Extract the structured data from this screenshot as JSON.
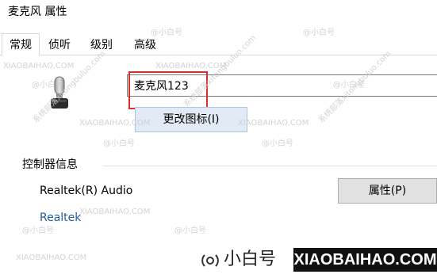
{
  "window": {
    "title": "麦克风 属性"
  },
  "tabs": [
    {
      "label": "常规",
      "active": true
    },
    {
      "label": "侦听",
      "active": false
    },
    {
      "label": "级别",
      "active": false
    },
    {
      "label": "高级",
      "active": false
    }
  ],
  "device": {
    "icon": "microphone-icon",
    "name_value": "麦克风123",
    "change_icon_label": "更改图标(I)"
  },
  "controller": {
    "section_title": "控制器信息",
    "name": "Realtek(R) Audio",
    "vendor_link": "Realtek",
    "properties_label": "属性(P)"
  },
  "watermarks": {
    "site_cn": "@小白号",
    "site_en": "XIAOBAIHAO.COM",
    "diagonal": "系统部落xitongbuluo.com"
  },
  "brand": {
    "cn": "小白号",
    "en": "XIAOBAIHAO.COM"
  },
  "colors": {
    "highlight": "#d9302b",
    "link": "#1f5c99",
    "button_focus_bg": "#e1eaf5"
  }
}
